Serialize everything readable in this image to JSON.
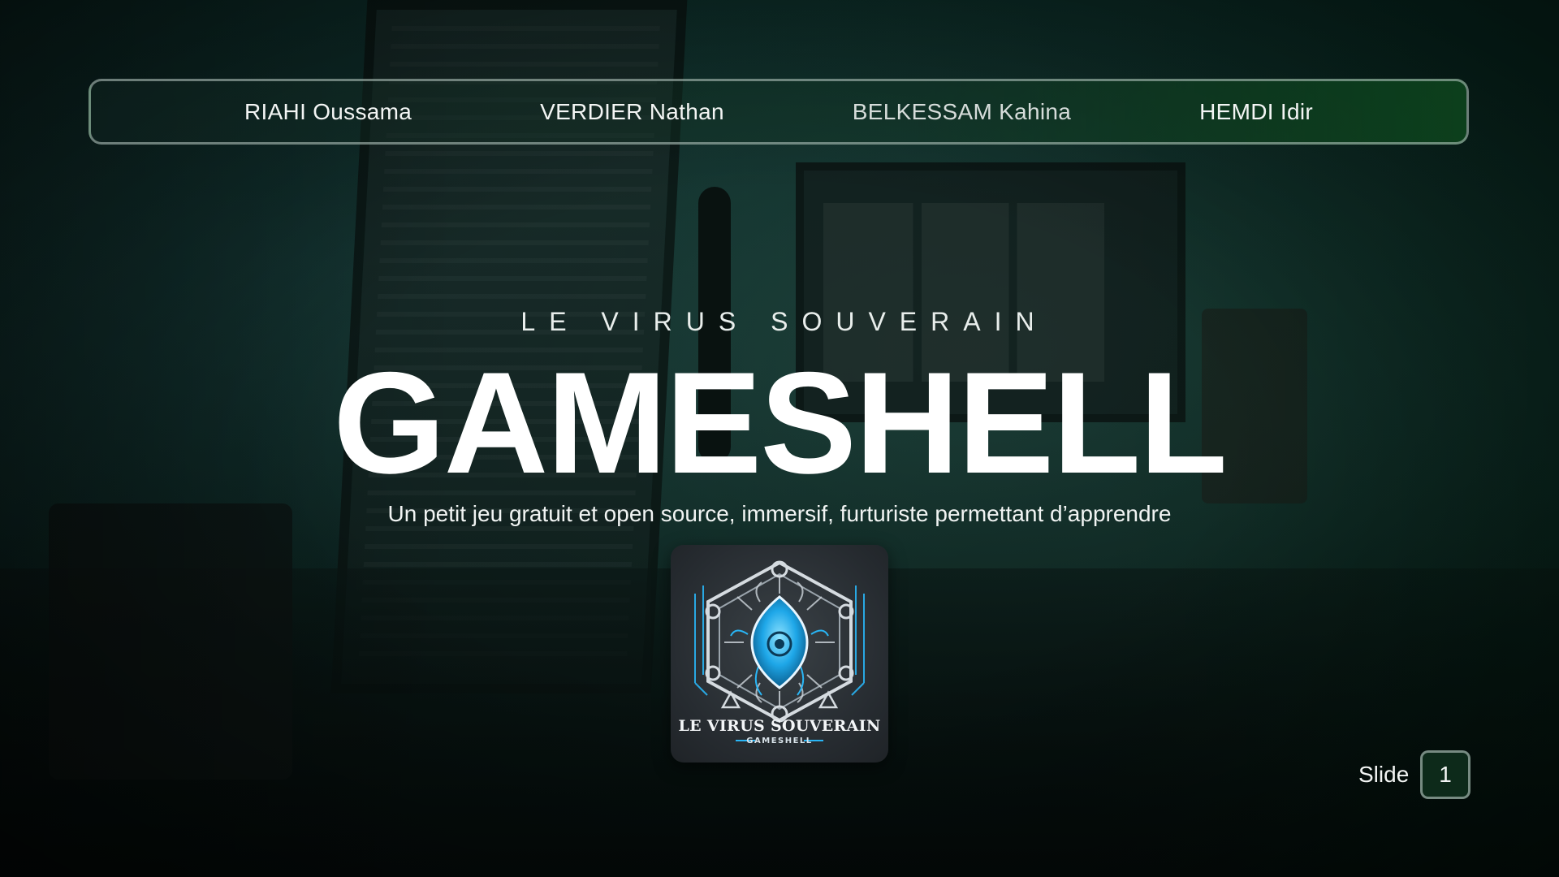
{
  "team": {
    "members": [
      "RIAHI Oussama",
      "VERDIER Nathan",
      "BELKESSAM Kahina",
      "HEMDI Idir"
    ]
  },
  "hero": {
    "kicker": "LE VIRUS SOUVERAIN",
    "title": "GAMESHELL",
    "tagline": "Un petit jeu gratuit et open source, immersif, furturiste permettant d’apprendre"
  },
  "logo": {
    "title": "LE VIRUS SOUVERAIN",
    "subtitle": "GAMESHELL",
    "accent_color": "#29b6f6"
  },
  "slide": {
    "label": "Slide",
    "number": "1"
  },
  "colors": {
    "background": "#0b2320",
    "accent_green": "#0e461e",
    "text": "#ffffff"
  }
}
